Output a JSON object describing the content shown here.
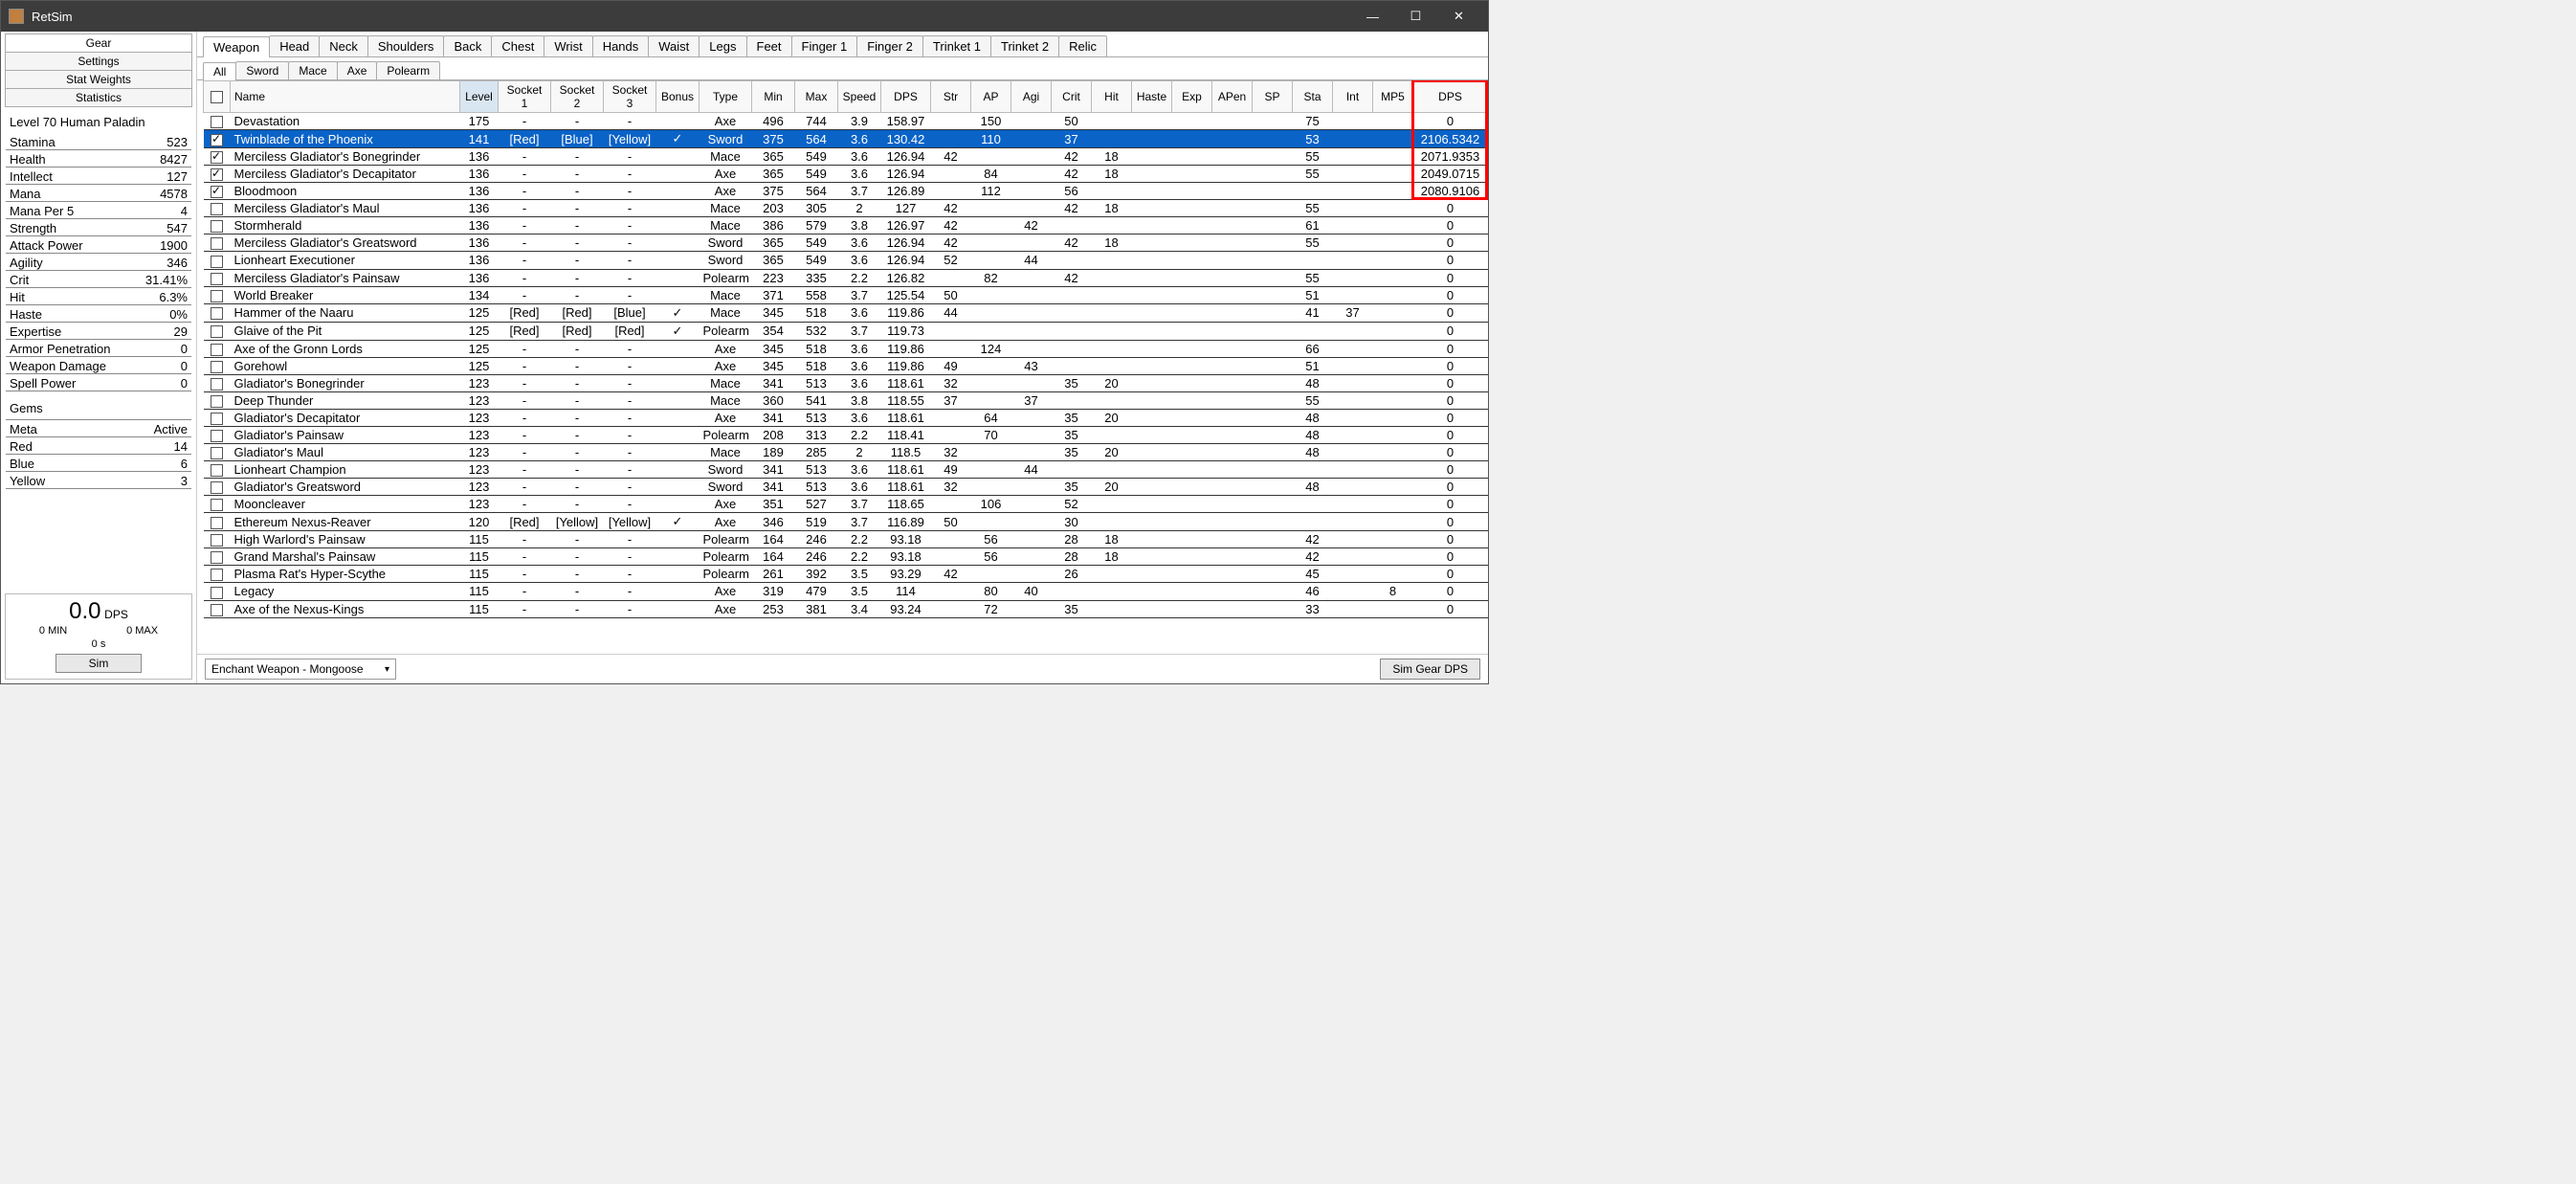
{
  "window": {
    "title": "RetSim"
  },
  "leftTabs": [
    "Gear",
    "Settings",
    "Stat Weights",
    "Statistics"
  ],
  "leftActive": 0,
  "charHeader": "Level 70 Human Paladin",
  "stats": [
    {
      "label": "Stamina",
      "value": "523"
    },
    {
      "label": "Health",
      "value": "8427"
    },
    {
      "label": "Intellect",
      "value": "127"
    },
    {
      "label": "Mana",
      "value": "4578"
    },
    {
      "label": "Mana Per 5",
      "value": "4"
    },
    {
      "label": "Strength",
      "value": "547"
    },
    {
      "label": "Attack Power",
      "value": "1900"
    },
    {
      "label": "Agility",
      "value": "346"
    },
    {
      "label": "Crit",
      "value": "31.41%"
    },
    {
      "label": "Hit",
      "value": "6.3%"
    },
    {
      "label": "Haste",
      "value": "0%"
    },
    {
      "label": "Expertise",
      "value": "29"
    },
    {
      "label": "Armor Penetration",
      "value": "0"
    },
    {
      "label": "Weapon Damage",
      "value": "0"
    },
    {
      "label": "Spell Power",
      "value": "0"
    }
  ],
  "gemsHeader": "Gems",
  "gems": [
    {
      "label": "Meta",
      "value": "Active"
    },
    {
      "label": "Red",
      "value": "14"
    },
    {
      "label": "Blue",
      "value": "6"
    },
    {
      "label": "Yellow",
      "value": "3"
    }
  ],
  "dpsBox": {
    "value": "0.0",
    "unit": "DPS",
    "min": "0 MIN",
    "max": "0 MAX",
    "time": "0 s",
    "simLabel": "Sim"
  },
  "slotTabs": [
    "Weapon",
    "Head",
    "Neck",
    "Shoulders",
    "Back",
    "Chest",
    "Wrist",
    "Hands",
    "Waist",
    "Legs",
    "Feet",
    "Finger 1",
    "Finger 2",
    "Trinket 1",
    "Trinket 2",
    "Relic"
  ],
  "slotActive": 0,
  "typeTabs": [
    "All",
    "Sword",
    "Mace",
    "Axe",
    "Polearm"
  ],
  "typeActive": 0,
  "columns": [
    "",
    "Name",
    "Level",
    "Socket 1",
    "Socket 2",
    "Socket 3",
    "Bonus",
    "Type",
    "Min",
    "Max",
    "Speed",
    "DPS",
    "Str",
    "AP",
    "Agi",
    "Crit",
    "Hit",
    "Haste",
    "Exp",
    "APen",
    "SP",
    "Sta",
    "Int",
    "MP5",
    "DPS"
  ],
  "sortedCol": 2,
  "rows": [
    {
      "chk": false,
      "sel": false,
      "name": "Devastation",
      "level": "175",
      "s1": "-",
      "s2": "-",
      "s3": "-",
      "bonus": "",
      "type": "Axe",
      "min": "496",
      "max": "744",
      "speed": "3.9",
      "dps": "158.97",
      "str": "",
      "ap": "150",
      "agi": "",
      "crit": "50",
      "hit": "",
      "haste": "",
      "exp": "",
      "apen": "",
      "sp": "",
      "sta": "75",
      "int": "",
      "mp5": "",
      "dpsr": "0"
    },
    {
      "chk": true,
      "sel": true,
      "name": "Twinblade of the Phoenix",
      "level": "141",
      "s1": "[Red]",
      "s2": "[Blue]",
      "s3": "[Yellow]",
      "bonus": "✓",
      "type": "Sword",
      "min": "375",
      "max": "564",
      "speed": "3.6",
      "dps": "130.42",
      "str": "",
      "ap": "110",
      "agi": "",
      "crit": "37",
      "hit": "",
      "haste": "",
      "exp": "",
      "apen": "",
      "sp": "",
      "sta": "53",
      "int": "",
      "mp5": "",
      "dpsr": "2106.5342"
    },
    {
      "chk": true,
      "sel": false,
      "name": "Merciless Gladiator's Bonegrinder",
      "level": "136",
      "s1": "-",
      "s2": "-",
      "s3": "-",
      "bonus": "",
      "type": "Mace",
      "min": "365",
      "max": "549",
      "speed": "3.6",
      "dps": "126.94",
      "str": "42",
      "ap": "",
      "agi": "",
      "crit": "42",
      "hit": "18",
      "haste": "",
      "exp": "",
      "apen": "",
      "sp": "",
      "sta": "55",
      "int": "",
      "mp5": "",
      "dpsr": "2071.9353"
    },
    {
      "chk": true,
      "sel": false,
      "name": "Merciless Gladiator's Decapitator",
      "level": "136",
      "s1": "-",
      "s2": "-",
      "s3": "-",
      "bonus": "",
      "type": "Axe",
      "min": "365",
      "max": "549",
      "speed": "3.6",
      "dps": "126.94",
      "str": "",
      "ap": "84",
      "agi": "",
      "crit": "42",
      "hit": "18",
      "haste": "",
      "exp": "",
      "apen": "",
      "sp": "",
      "sta": "55",
      "int": "",
      "mp5": "",
      "dpsr": "2049.0715"
    },
    {
      "chk": true,
      "sel": false,
      "name": "Bloodmoon",
      "level": "136",
      "s1": "-",
      "s2": "-",
      "s3": "-",
      "bonus": "",
      "type": "Axe",
      "min": "375",
      "max": "564",
      "speed": "3.7",
      "dps": "126.89",
      "str": "",
      "ap": "112",
      "agi": "",
      "crit": "56",
      "hit": "",
      "haste": "",
      "exp": "",
      "apen": "",
      "sp": "",
      "sta": "",
      "int": "",
      "mp5": "",
      "dpsr": "2080.9106"
    },
    {
      "chk": false,
      "sel": false,
      "name": "Merciless Gladiator's Maul",
      "level": "136",
      "s1": "-",
      "s2": "-",
      "s3": "-",
      "bonus": "",
      "type": "Mace",
      "min": "203",
      "max": "305",
      "speed": "2",
      "dps": "127",
      "str": "42",
      "ap": "",
      "agi": "",
      "crit": "42",
      "hit": "18",
      "haste": "",
      "exp": "",
      "apen": "",
      "sp": "",
      "sta": "55",
      "int": "",
      "mp5": "",
      "dpsr": "0"
    },
    {
      "chk": false,
      "sel": false,
      "name": "Stormherald",
      "level": "136",
      "s1": "-",
      "s2": "-",
      "s3": "-",
      "bonus": "",
      "type": "Mace",
      "min": "386",
      "max": "579",
      "speed": "3.8",
      "dps": "126.97",
      "str": "42",
      "ap": "",
      "agi": "42",
      "crit": "",
      "hit": "",
      "haste": "",
      "exp": "",
      "apen": "",
      "sp": "",
      "sta": "61",
      "int": "",
      "mp5": "",
      "dpsr": "0"
    },
    {
      "chk": false,
      "sel": false,
      "name": "Merciless Gladiator's Greatsword",
      "level": "136",
      "s1": "-",
      "s2": "-",
      "s3": "-",
      "bonus": "",
      "type": "Sword",
      "min": "365",
      "max": "549",
      "speed": "3.6",
      "dps": "126.94",
      "str": "42",
      "ap": "",
      "agi": "",
      "crit": "42",
      "hit": "18",
      "haste": "",
      "exp": "",
      "apen": "",
      "sp": "",
      "sta": "55",
      "int": "",
      "mp5": "",
      "dpsr": "0"
    },
    {
      "chk": false,
      "sel": false,
      "name": "Lionheart Executioner",
      "level": "136",
      "s1": "-",
      "s2": "-",
      "s3": "-",
      "bonus": "",
      "type": "Sword",
      "min": "365",
      "max": "549",
      "speed": "3.6",
      "dps": "126.94",
      "str": "52",
      "ap": "",
      "agi": "44",
      "crit": "",
      "hit": "",
      "haste": "",
      "exp": "",
      "apen": "",
      "sp": "",
      "sta": "",
      "int": "",
      "mp5": "",
      "dpsr": "0"
    },
    {
      "chk": false,
      "sel": false,
      "name": "Merciless Gladiator's Painsaw",
      "level": "136",
      "s1": "-",
      "s2": "-",
      "s3": "-",
      "bonus": "",
      "type": "Polearm",
      "min": "223",
      "max": "335",
      "speed": "2.2",
      "dps": "126.82",
      "str": "",
      "ap": "82",
      "agi": "",
      "crit": "42",
      "hit": "",
      "haste": "",
      "exp": "",
      "apen": "",
      "sp": "",
      "sta": "55",
      "int": "",
      "mp5": "",
      "dpsr": "0"
    },
    {
      "chk": false,
      "sel": false,
      "name": "World Breaker",
      "level": "134",
      "s1": "-",
      "s2": "-",
      "s3": "-",
      "bonus": "",
      "type": "Mace",
      "min": "371",
      "max": "558",
      "speed": "3.7",
      "dps": "125.54",
      "str": "50",
      "ap": "",
      "agi": "",
      "crit": "",
      "hit": "",
      "haste": "",
      "exp": "",
      "apen": "",
      "sp": "",
      "sta": "51",
      "int": "",
      "mp5": "",
      "dpsr": "0"
    },
    {
      "chk": false,
      "sel": false,
      "name": "Hammer of the Naaru",
      "level": "125",
      "s1": "[Red]",
      "s2": "[Red]",
      "s3": "[Blue]",
      "bonus": "✓",
      "type": "Mace",
      "min": "345",
      "max": "518",
      "speed": "3.6",
      "dps": "119.86",
      "str": "44",
      "ap": "",
      "agi": "",
      "crit": "",
      "hit": "",
      "haste": "",
      "exp": "",
      "apen": "",
      "sp": "",
      "sta": "41",
      "int": "37",
      "mp5": "",
      "dpsr": "0"
    },
    {
      "chk": false,
      "sel": false,
      "name": "Glaive of the Pit",
      "level": "125",
      "s1": "[Red]",
      "s2": "[Red]",
      "s3": "[Red]",
      "bonus": "✓",
      "type": "Polearm",
      "min": "354",
      "max": "532",
      "speed": "3.7",
      "dps": "119.73",
      "str": "",
      "ap": "",
      "agi": "",
      "crit": "",
      "hit": "",
      "haste": "",
      "exp": "",
      "apen": "",
      "sp": "",
      "sta": "",
      "int": "",
      "mp5": "",
      "dpsr": "0"
    },
    {
      "chk": false,
      "sel": false,
      "name": "Axe of the Gronn Lords",
      "level": "125",
      "s1": "-",
      "s2": "-",
      "s3": "-",
      "bonus": "",
      "type": "Axe",
      "min": "345",
      "max": "518",
      "speed": "3.6",
      "dps": "119.86",
      "str": "",
      "ap": "124",
      "agi": "",
      "crit": "",
      "hit": "",
      "haste": "",
      "exp": "",
      "apen": "",
      "sp": "",
      "sta": "66",
      "int": "",
      "mp5": "",
      "dpsr": "0"
    },
    {
      "chk": false,
      "sel": false,
      "name": "Gorehowl",
      "level": "125",
      "s1": "-",
      "s2": "-",
      "s3": "-",
      "bonus": "",
      "type": "Axe",
      "min": "345",
      "max": "518",
      "speed": "3.6",
      "dps": "119.86",
      "str": "49",
      "ap": "",
      "agi": "43",
      "crit": "",
      "hit": "",
      "haste": "",
      "exp": "",
      "apen": "",
      "sp": "",
      "sta": "51",
      "int": "",
      "mp5": "",
      "dpsr": "0"
    },
    {
      "chk": false,
      "sel": false,
      "name": "Gladiator's Bonegrinder",
      "level": "123",
      "s1": "-",
      "s2": "-",
      "s3": "-",
      "bonus": "",
      "type": "Mace",
      "min": "341",
      "max": "513",
      "speed": "3.6",
      "dps": "118.61",
      "str": "32",
      "ap": "",
      "agi": "",
      "crit": "35",
      "hit": "20",
      "haste": "",
      "exp": "",
      "apen": "",
      "sp": "",
      "sta": "48",
      "int": "",
      "mp5": "",
      "dpsr": "0"
    },
    {
      "chk": false,
      "sel": false,
      "name": "Deep Thunder",
      "level": "123",
      "s1": "-",
      "s2": "-",
      "s3": "-",
      "bonus": "",
      "type": "Mace",
      "min": "360",
      "max": "541",
      "speed": "3.8",
      "dps": "118.55",
      "str": "37",
      "ap": "",
      "agi": "37",
      "crit": "",
      "hit": "",
      "haste": "",
      "exp": "",
      "apen": "",
      "sp": "",
      "sta": "55",
      "int": "",
      "mp5": "",
      "dpsr": "0"
    },
    {
      "chk": false,
      "sel": false,
      "name": "Gladiator's Decapitator",
      "level": "123",
      "s1": "-",
      "s2": "-",
      "s3": "-",
      "bonus": "",
      "type": "Axe",
      "min": "341",
      "max": "513",
      "speed": "3.6",
      "dps": "118.61",
      "str": "",
      "ap": "64",
      "agi": "",
      "crit": "35",
      "hit": "20",
      "haste": "",
      "exp": "",
      "apen": "",
      "sp": "",
      "sta": "48",
      "int": "",
      "mp5": "",
      "dpsr": "0"
    },
    {
      "chk": false,
      "sel": false,
      "name": "Gladiator's Painsaw",
      "level": "123",
      "s1": "-",
      "s2": "-",
      "s3": "-",
      "bonus": "",
      "type": "Polearm",
      "min": "208",
      "max": "313",
      "speed": "2.2",
      "dps": "118.41",
      "str": "",
      "ap": "70",
      "agi": "",
      "crit": "35",
      "hit": "",
      "haste": "",
      "exp": "",
      "apen": "",
      "sp": "",
      "sta": "48",
      "int": "",
      "mp5": "",
      "dpsr": "0"
    },
    {
      "chk": false,
      "sel": false,
      "name": "Gladiator's Maul",
      "level": "123",
      "s1": "-",
      "s2": "-",
      "s3": "-",
      "bonus": "",
      "type": "Mace",
      "min": "189",
      "max": "285",
      "speed": "2",
      "dps": "118.5",
      "str": "32",
      "ap": "",
      "agi": "",
      "crit": "35",
      "hit": "20",
      "haste": "",
      "exp": "",
      "apen": "",
      "sp": "",
      "sta": "48",
      "int": "",
      "mp5": "",
      "dpsr": "0"
    },
    {
      "chk": false,
      "sel": false,
      "name": "Lionheart Champion",
      "level": "123",
      "s1": "-",
      "s2": "-",
      "s3": "-",
      "bonus": "",
      "type": "Sword",
      "min": "341",
      "max": "513",
      "speed": "3.6",
      "dps": "118.61",
      "str": "49",
      "ap": "",
      "agi": "44",
      "crit": "",
      "hit": "",
      "haste": "",
      "exp": "",
      "apen": "",
      "sp": "",
      "sta": "",
      "int": "",
      "mp5": "",
      "dpsr": "0"
    },
    {
      "chk": false,
      "sel": false,
      "name": "Gladiator's Greatsword",
      "level": "123",
      "s1": "-",
      "s2": "-",
      "s3": "-",
      "bonus": "",
      "type": "Sword",
      "min": "341",
      "max": "513",
      "speed": "3.6",
      "dps": "118.61",
      "str": "32",
      "ap": "",
      "agi": "",
      "crit": "35",
      "hit": "20",
      "haste": "",
      "exp": "",
      "apen": "",
      "sp": "",
      "sta": "48",
      "int": "",
      "mp5": "",
      "dpsr": "0"
    },
    {
      "chk": false,
      "sel": false,
      "name": "Mooncleaver",
      "level": "123",
      "s1": "-",
      "s2": "-",
      "s3": "-",
      "bonus": "",
      "type": "Axe",
      "min": "351",
      "max": "527",
      "speed": "3.7",
      "dps": "118.65",
      "str": "",
      "ap": "106",
      "agi": "",
      "crit": "52",
      "hit": "",
      "haste": "",
      "exp": "",
      "apen": "",
      "sp": "",
      "sta": "",
      "int": "",
      "mp5": "",
      "dpsr": "0"
    },
    {
      "chk": false,
      "sel": false,
      "name": "Ethereum Nexus-Reaver",
      "level": "120",
      "s1": "[Red]",
      "s2": "[Yellow]",
      "s3": "[Yellow]",
      "bonus": "✓",
      "type": "Axe",
      "min": "346",
      "max": "519",
      "speed": "3.7",
      "dps": "116.89",
      "str": "50",
      "ap": "",
      "agi": "",
      "crit": "30",
      "hit": "",
      "haste": "",
      "exp": "",
      "apen": "",
      "sp": "",
      "sta": "",
      "int": "",
      "mp5": "",
      "dpsr": "0"
    },
    {
      "chk": false,
      "sel": false,
      "name": "High Warlord's Painsaw",
      "level": "115",
      "s1": "-",
      "s2": "-",
      "s3": "-",
      "bonus": "",
      "type": "Polearm",
      "min": "164",
      "max": "246",
      "speed": "2.2",
      "dps": "93.18",
      "str": "",
      "ap": "56",
      "agi": "",
      "crit": "28",
      "hit": "18",
      "haste": "",
      "exp": "",
      "apen": "",
      "sp": "",
      "sta": "42",
      "int": "",
      "mp5": "",
      "dpsr": "0"
    },
    {
      "chk": false,
      "sel": false,
      "name": "Grand Marshal's Painsaw",
      "level": "115",
      "s1": "-",
      "s2": "-",
      "s3": "-",
      "bonus": "",
      "type": "Polearm",
      "min": "164",
      "max": "246",
      "speed": "2.2",
      "dps": "93.18",
      "str": "",
      "ap": "56",
      "agi": "",
      "crit": "28",
      "hit": "18",
      "haste": "",
      "exp": "",
      "apen": "",
      "sp": "",
      "sta": "42",
      "int": "",
      "mp5": "",
      "dpsr": "0"
    },
    {
      "chk": false,
      "sel": false,
      "name": "Plasma Rat's Hyper-Scythe",
      "level": "115",
      "s1": "-",
      "s2": "-",
      "s3": "-",
      "bonus": "",
      "type": "Polearm",
      "min": "261",
      "max": "392",
      "speed": "3.5",
      "dps": "93.29",
      "str": "42",
      "ap": "",
      "agi": "",
      "crit": "26",
      "hit": "",
      "haste": "",
      "exp": "",
      "apen": "",
      "sp": "",
      "sta": "45",
      "int": "",
      "mp5": "",
      "dpsr": "0"
    },
    {
      "chk": false,
      "sel": false,
      "name": "Legacy",
      "level": "115",
      "s1": "-",
      "s2": "-",
      "s3": "-",
      "bonus": "",
      "type": "Axe",
      "min": "319",
      "max": "479",
      "speed": "3.5",
      "dps": "114",
      "str": "",
      "ap": "80",
      "agi": "40",
      "crit": "",
      "hit": "",
      "haste": "",
      "exp": "",
      "apen": "",
      "sp": "",
      "sta": "46",
      "int": "",
      "mp5": "8",
      "dpsr": "0"
    },
    {
      "chk": false,
      "sel": false,
      "name": "Axe of the Nexus-Kings",
      "level": "115",
      "s1": "-",
      "s2": "-",
      "s3": "-",
      "bonus": "",
      "type": "Axe",
      "min": "253",
      "max": "381",
      "speed": "3.4",
      "dps": "93.24",
      "str": "",
      "ap": "72",
      "agi": "",
      "crit": "35",
      "hit": "",
      "haste": "",
      "exp": "",
      "apen": "",
      "sp": "",
      "sta": "33",
      "int": "",
      "mp5": "",
      "dpsr": "0"
    }
  ],
  "enchant": "Enchant Weapon - Mongoose",
  "simGearBtn": "Sim Gear DPS"
}
